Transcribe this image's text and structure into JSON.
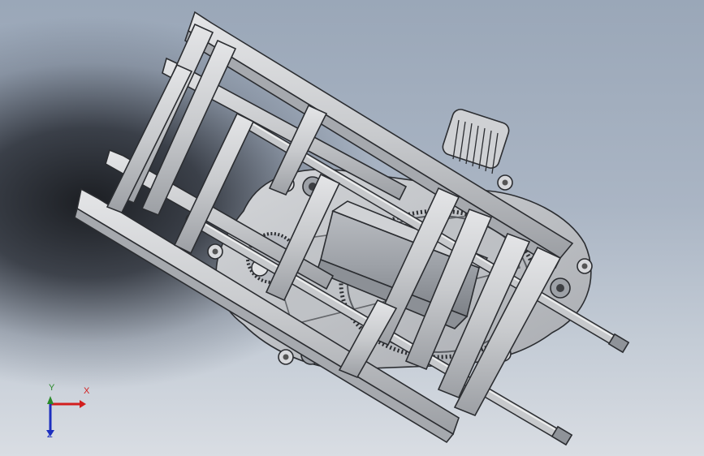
{
  "scene": {
    "background_top": "#9aa7b8",
    "background_bottom": "#d9dde3",
    "part_color": "#c9cbce",
    "edge_color": "#2b2d31"
  },
  "axes": {
    "x_label": "X",
    "y_label": "Y",
    "z_label": "Z",
    "x_color": "#d21e1e",
    "y_color": "#2a8a2a",
    "z_color": "#1d2fbf"
  }
}
